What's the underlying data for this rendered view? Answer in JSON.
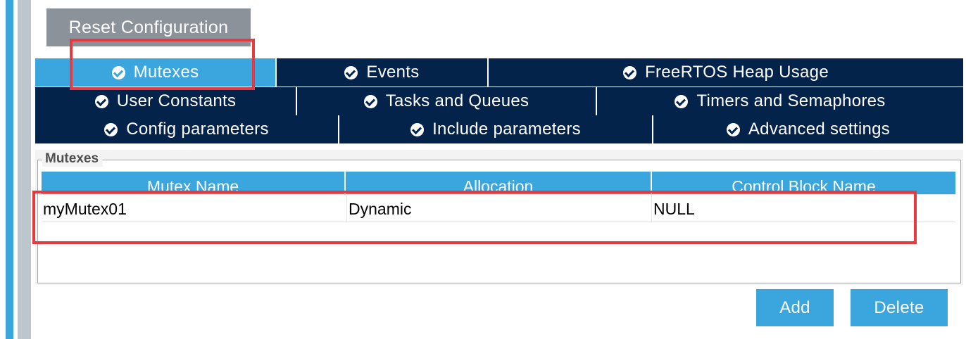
{
  "reset_button": {
    "label": "Reset Configuration"
  },
  "tabs": {
    "row1": [
      {
        "label": "Mutexes",
        "active": true
      },
      {
        "label": "Events",
        "active": false
      },
      {
        "label": "FreeRTOS Heap Usage",
        "active": false
      }
    ],
    "row2": [
      {
        "label": "User Constants"
      },
      {
        "label": "Tasks and Queues"
      },
      {
        "label": "Timers and Semaphores"
      }
    ],
    "row3": [
      {
        "label": "Config parameters"
      },
      {
        "label": "Include parameters"
      },
      {
        "label": "Advanced settings"
      }
    ]
  },
  "panel": {
    "legend": "Mutexes",
    "columns": [
      "Mutex Name",
      "Allocation",
      "Control Block Name"
    ],
    "rows": [
      [
        "myMutex01",
        "Dynamic",
        "NULL"
      ]
    ]
  },
  "actions": {
    "add_label": "Add",
    "delete_label": "Delete"
  },
  "colors": {
    "accent": "#3aa6dd",
    "tab_dark": "#03234b",
    "reset_gray": "#8b9299",
    "highlight_red": "#e53a3f"
  }
}
